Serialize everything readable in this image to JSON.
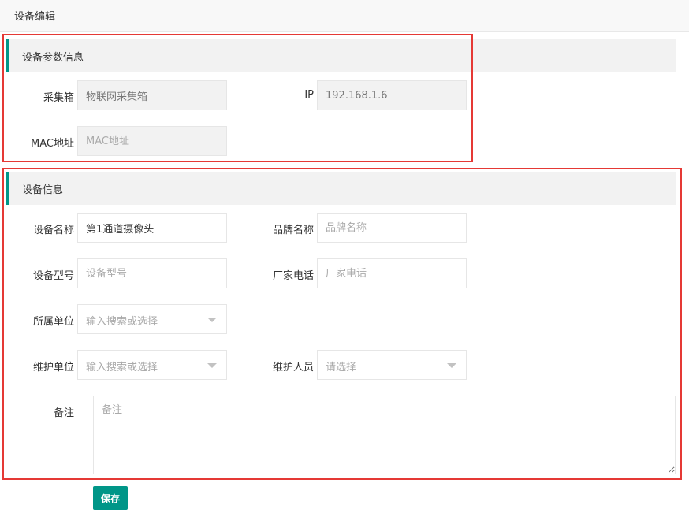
{
  "header": {
    "title": "设备编辑"
  },
  "params_section": {
    "title": "设备参数信息",
    "collector": {
      "label": "采集箱",
      "value": "物联网采集箱"
    },
    "ip": {
      "label": "IP",
      "value": "192.168.1.6"
    },
    "mac": {
      "label": "MAC地址",
      "placeholder": "MAC地址"
    }
  },
  "device_section": {
    "title": "设备信息",
    "name": {
      "label": "设备名称",
      "value": "第1通道摄像头"
    },
    "brand": {
      "label": "品牌名称",
      "placeholder": "品牌名称"
    },
    "model": {
      "label": "设备型号",
      "placeholder": "设备型号"
    },
    "vendor_phone": {
      "label": "厂家电话",
      "placeholder": "厂家电话"
    },
    "owner_unit": {
      "label": "所属单位",
      "placeholder": "输入搜索或选择"
    },
    "maint_unit": {
      "label": "维护单位",
      "placeholder": "输入搜索或选择"
    },
    "maint_person": {
      "label": "维护人员",
      "placeholder": "请选择"
    },
    "remark": {
      "label": "备注",
      "placeholder": "备注"
    }
  },
  "actions": {
    "save_label": "保存"
  },
  "colors": {
    "accent": "#009688",
    "highlight_border": "#e53935",
    "section_bg": "#f2f2f2"
  }
}
